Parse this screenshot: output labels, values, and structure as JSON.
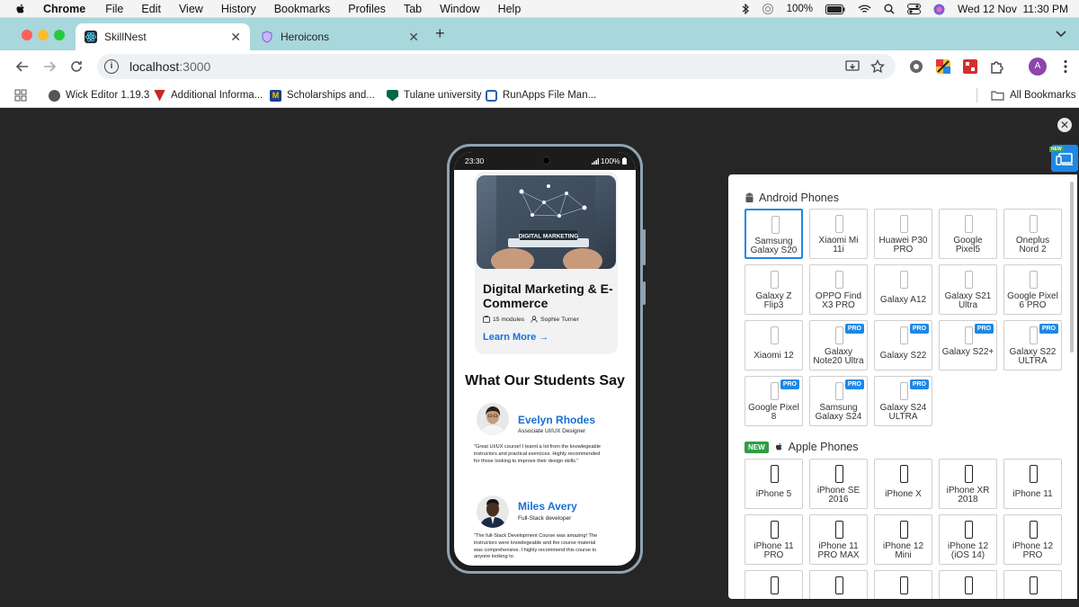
{
  "menubar": {
    "app": "Chrome",
    "items": [
      "File",
      "Edit",
      "View",
      "History",
      "Bookmarks",
      "Profiles",
      "Tab",
      "Window",
      "Help"
    ],
    "battery": "100%",
    "datetime": "Wed 12 Nov  11:30 PM"
  },
  "tabs": [
    {
      "title": "SkillNest",
      "active": true
    },
    {
      "title": "Heroicons",
      "active": false
    }
  ],
  "toolbar": {
    "url_host": "localhost",
    "url_port": ":3000",
    "profile_initial": "A"
  },
  "bookmarks": {
    "items": [
      "Wick Editor 1.19.3",
      "Additional Informa...",
      "Scholarships and...",
      "Tulane university",
      "RunApps File Man..."
    ],
    "all_label": "All Bookmarks"
  },
  "phone": {
    "time": "23:30",
    "battery": "100%",
    "course": {
      "image_text": "DIGITAL MARKETING",
      "title": "Digital Marketing & E-Commerce",
      "modules": "15 modules",
      "instructor": "Sophie Turner",
      "cta": "Learn More →"
    },
    "testimonials_title": "What Our Students Say",
    "testimonials": [
      {
        "name": "Evelyn Rhodes",
        "role": "Associate UI/UX Designer",
        "quote": "\"Great UI/UX course! I learnt a lot from the knowlegeable instructors and practical exercices. Highly recommended for those looking to improve their design skills.\""
      },
      {
        "name": "Miles Avery",
        "role": "Full-Stack developer",
        "quote": "\"The full-Stack Development Course was amazing! The instructors were knowlegeable and the course material was comprehensive. I highly recommend this course to anyone looking to"
      }
    ]
  },
  "device_panel": {
    "new_badge": "NEW",
    "android_title": "Android Phones",
    "apple_title": "Apple Phones",
    "new_chip": "NEW",
    "pro_label": "PRO",
    "android": [
      {
        "name": "Samsung Galaxy S20",
        "pro": false,
        "selected": true
      },
      {
        "name": "Xiaomi Mi 11i",
        "pro": false
      },
      {
        "name": "Huawei P30 PRO",
        "pro": false
      },
      {
        "name": "Google Pixel5",
        "pro": false
      },
      {
        "name": "Oneplus Nord 2",
        "pro": false
      },
      {
        "name": "Galaxy Z Flip3",
        "pro": false
      },
      {
        "name": "OPPO Find X3 PRO",
        "pro": false
      },
      {
        "name": "Galaxy A12",
        "pro": false
      },
      {
        "name": "Galaxy S21 Ultra",
        "pro": false
      },
      {
        "name": "Google Pixel 6 PRO",
        "pro": false
      },
      {
        "name": "Xiaomi 12",
        "pro": false
      },
      {
        "name": "Galaxy Note20 Ultra",
        "pro": true
      },
      {
        "name": "Galaxy S22",
        "pro": true
      },
      {
        "name": "Galaxy S22+",
        "pro": true
      },
      {
        "name": "Galaxy S22 ULTRA",
        "pro": true
      },
      {
        "name": "Google Pixel 8",
        "pro": true
      },
      {
        "name": "Samsung Galaxy S24",
        "pro": true
      },
      {
        "name": "Galaxy S24 ULTRA",
        "pro": true
      }
    ],
    "apple": [
      {
        "name": "iPhone 5"
      },
      {
        "name": "iPhone SE 2016"
      },
      {
        "name": "iPhone X"
      },
      {
        "name": "iPhone XR 2018"
      },
      {
        "name": "iPhone 11"
      },
      {
        "name": "iPhone 11 PRO"
      },
      {
        "name": "iPhone 11 PRO MAX"
      },
      {
        "name": "iPhone 12 Mini"
      },
      {
        "name": "iPhone 12 (iOS 14)"
      },
      {
        "name": "iPhone 12 PRO"
      }
    ]
  },
  "colors": {
    "tabstrip": "#a8d7dc",
    "accent_blue": "#1a6fd6",
    "pro_badge": "#1e88e5",
    "new_green": "#2e9d46"
  }
}
